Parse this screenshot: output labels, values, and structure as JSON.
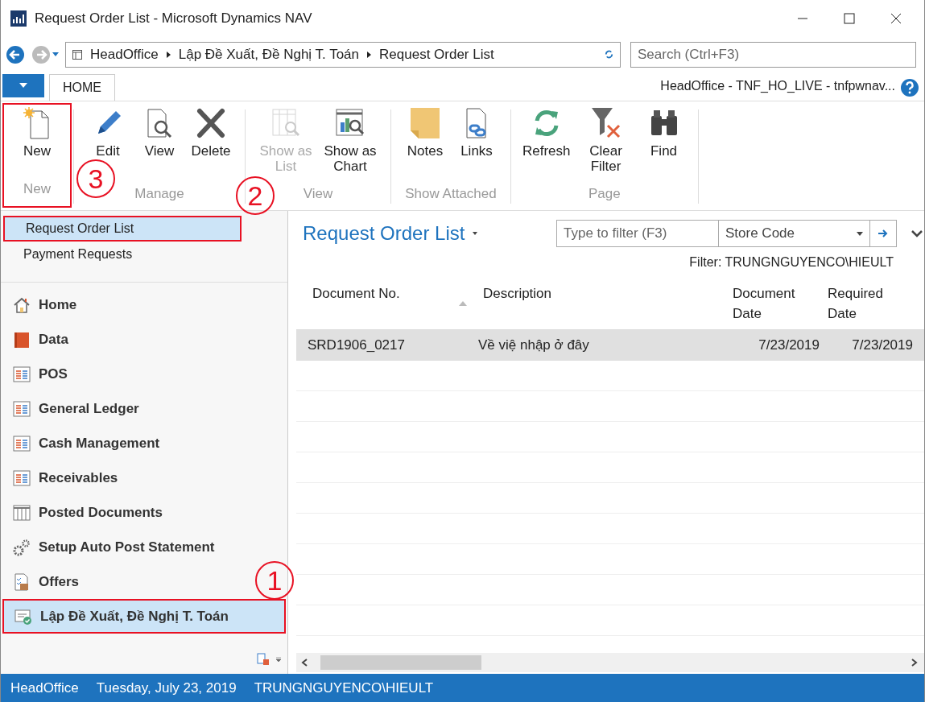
{
  "window": {
    "title": "Request Order List - Microsoft Dynamics NAV"
  },
  "address_bar": {
    "crumbs": [
      "HeadOffice",
      "Lập Đề Xuất, Đề Nghị T. Toán",
      "Request Order List"
    ]
  },
  "search": {
    "placeholder": "Search (Ctrl+F3)"
  },
  "tabs": [
    {
      "label": "HOME",
      "selected": true
    }
  ],
  "session": "HeadOffice - TNF_HO_LIVE - tnfpwnav...",
  "ribbon": [
    {
      "label": "New",
      "actions": [
        {
          "label": "New",
          "kind": "new",
          "disabled": false,
          "annotated": true
        }
      ]
    },
    {
      "label": "Manage",
      "actions": [
        {
          "label": "Edit",
          "kind": "edit",
          "disabled": false,
          "annotated": false
        },
        {
          "label": "View",
          "kind": "view",
          "disabled": false,
          "annotated": false
        },
        {
          "label": "Delete",
          "kind": "delete",
          "disabled": false,
          "annotated": false
        }
      ]
    },
    {
      "label": "View",
      "actions": [
        {
          "label": "Show as List",
          "kind": "list",
          "disabled": true,
          "annotated": false
        },
        {
          "label": "Show as Chart",
          "kind": "chart",
          "disabled": false,
          "annotated": false
        }
      ]
    },
    {
      "label": "Show Attached",
      "actions": [
        {
          "label": "Notes",
          "kind": "notes",
          "disabled": false,
          "annotated": false
        },
        {
          "label": "Links",
          "kind": "links",
          "disabled": false,
          "annotated": false
        }
      ]
    },
    {
      "label": "Page",
      "actions": [
        {
          "label": "Refresh",
          "kind": "refresh",
          "disabled": false,
          "annotated": false
        },
        {
          "label": "Clear Filter",
          "kind": "clearfilter",
          "disabled": false,
          "annotated": false
        },
        {
          "label": "Find",
          "kind": "find",
          "disabled": false,
          "annotated": false
        }
      ]
    }
  ],
  "sidebar": {
    "items": [
      {
        "label": "Request Order List",
        "selected": true,
        "annotated": true
      },
      {
        "label": "Payment Requests",
        "selected": false,
        "annotated": false
      }
    ],
    "nav": [
      {
        "label": "Home",
        "kind": "home",
        "selected": false,
        "annotated": false
      },
      {
        "label": "Data",
        "kind": "book",
        "selected": false,
        "annotated": false
      },
      {
        "label": "POS",
        "kind": "report",
        "selected": false,
        "annotated": false
      },
      {
        "label": "General Ledger",
        "kind": "report",
        "selected": false,
        "annotated": false
      },
      {
        "label": "Cash Management",
        "kind": "report",
        "selected": false,
        "annotated": false
      },
      {
        "label": "Receivables",
        "kind": "report",
        "selected": false,
        "annotated": false
      },
      {
        "label": "Posted Documents",
        "kind": "table",
        "selected": false,
        "annotated": false
      },
      {
        "label": "Setup Auto Post Statement",
        "kind": "gears",
        "selected": false,
        "annotated": false
      },
      {
        "label": "Offers",
        "kind": "offers",
        "selected": false,
        "annotated": false
      },
      {
        "label": "Lập Đề Xuất, Đề Nghị T. Toán",
        "kind": "approved",
        "selected": true,
        "annotated": true
      }
    ]
  },
  "page": {
    "title": "Request Order List",
    "filter_placeholder": "Type to filter (F3)",
    "filter_field": "Store Code",
    "filter_text": "Filter: TRUNGNGUYENCO\\HIEULT"
  },
  "table": {
    "columns": [
      {
        "label": "Document No.",
        "sorted": true
      },
      {
        "label": "Description",
        "sorted": false
      },
      {
        "label": "Document Date",
        "sorted": false
      },
      {
        "label": "Required Date",
        "sorted": false
      }
    ],
    "rows": [
      {
        "cells": [
          "SRD1906_0217",
          "Về việ nhập ở đây",
          "7/23/2019",
          "7/23/2019"
        ],
        "selected": true
      }
    ]
  },
  "status_bar": [
    "HeadOffice",
    "Tuesday, July 23, 2019",
    "TRUNGNGUYENCO\\HIEULT"
  ],
  "annotations": [
    {
      "label": "1"
    },
    {
      "label": "2"
    },
    {
      "label": "3"
    }
  ]
}
